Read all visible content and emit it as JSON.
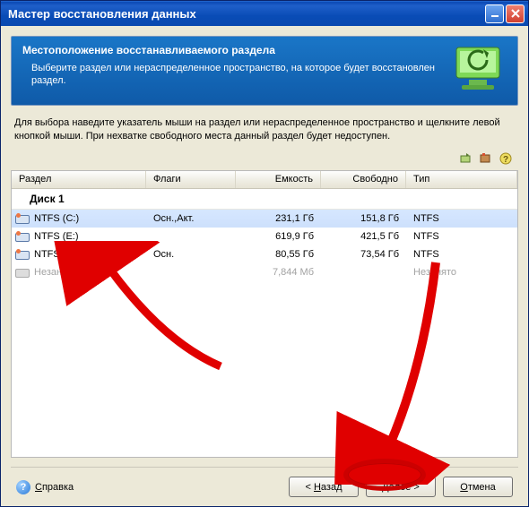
{
  "window": {
    "title": "Мастер восстановления данных"
  },
  "banner": {
    "title": "Местоположение восстанавливаемого раздела",
    "desc": "Выберите раздел или нераспределенное пространство, на которое будет восстановлен раздел."
  },
  "instructions": "Для выбора наведите указатель мыши на раздел или нераспределенное пространство и щелкните левой кнопкой мыши. При нехватке свободного места данный раздел будет недоступен.",
  "columns": {
    "partition": "Раздел",
    "flags": "Флаги",
    "capacity": "Емкость",
    "free": "Свободно",
    "type": "Тип"
  },
  "group": "Диск 1",
  "rows": [
    {
      "name": "NTFS (C:)",
      "flags": "Осн.,Акт.",
      "cap": "231,1 Гб",
      "free": "151,8 Гб",
      "type": "NTFS",
      "sel": true,
      "disabled": false
    },
    {
      "name": "NTFS (E:)",
      "flags": "",
      "cap": "619,9 Гб",
      "free": "421,5 Гб",
      "type": "NTFS",
      "sel": false,
      "disabled": false
    },
    {
      "name": "NTFS (M:)",
      "flags": "Осн.",
      "cap": "80,55 Гб",
      "free": "73,54 Гб",
      "type": "NTFS",
      "sel": false,
      "disabled": false
    },
    {
      "name": "Незанято",
      "flags": "",
      "cap": "7,844 Мб",
      "free": "",
      "type": "Незанято",
      "sel": false,
      "disabled": true
    }
  ],
  "buttons": {
    "help": "Справка",
    "back": "Назад",
    "next": "Далее",
    "cancel": "Отмена"
  }
}
